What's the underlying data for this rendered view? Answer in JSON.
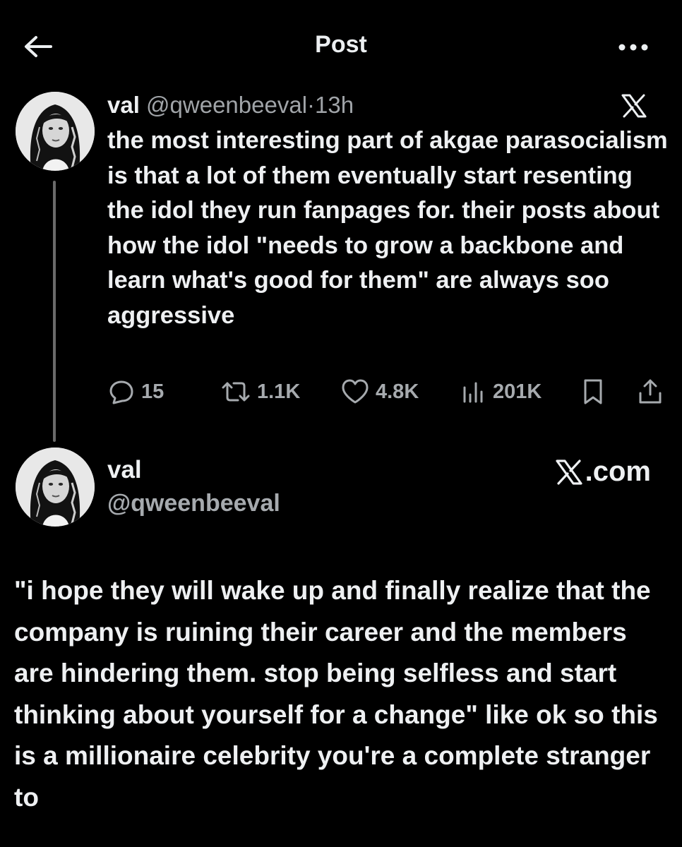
{
  "header": {
    "title": "Post",
    "back_icon": "arrow-left-icon",
    "more_icon": "more-horizontal-icon"
  },
  "tweet": {
    "name": "val",
    "handle": "@qweenbeeval",
    "separator": "·",
    "time": "13h",
    "platform_icon": "x-logo-icon",
    "text": "the most interesting part of akgae parasocialism is that a lot of them eventually start resenting the idol they run fanpages for. their posts about how the idol \"needs to grow a backbone and learn what's good for them\" are always soo aggressive",
    "actions": {
      "replies": "15",
      "reposts": "1.1K",
      "likes": "4.8K",
      "views": "201K"
    }
  },
  "quoted": {
    "name": "val",
    "handle": "@qweenbeeval",
    "source": ".com",
    "text": "\"i hope they will wake up and finally realize that the company is ruining their career and the members are hindering them. stop being selfless and start thinking about yourself for a change\" like ok so this is a millionaire celebrity you're a complete stranger to"
  },
  "colors": {
    "background": "#000000",
    "text_primary": "#eef0f2",
    "text_secondary": "#a6aaae",
    "thread_line": "#6a6a6a"
  }
}
